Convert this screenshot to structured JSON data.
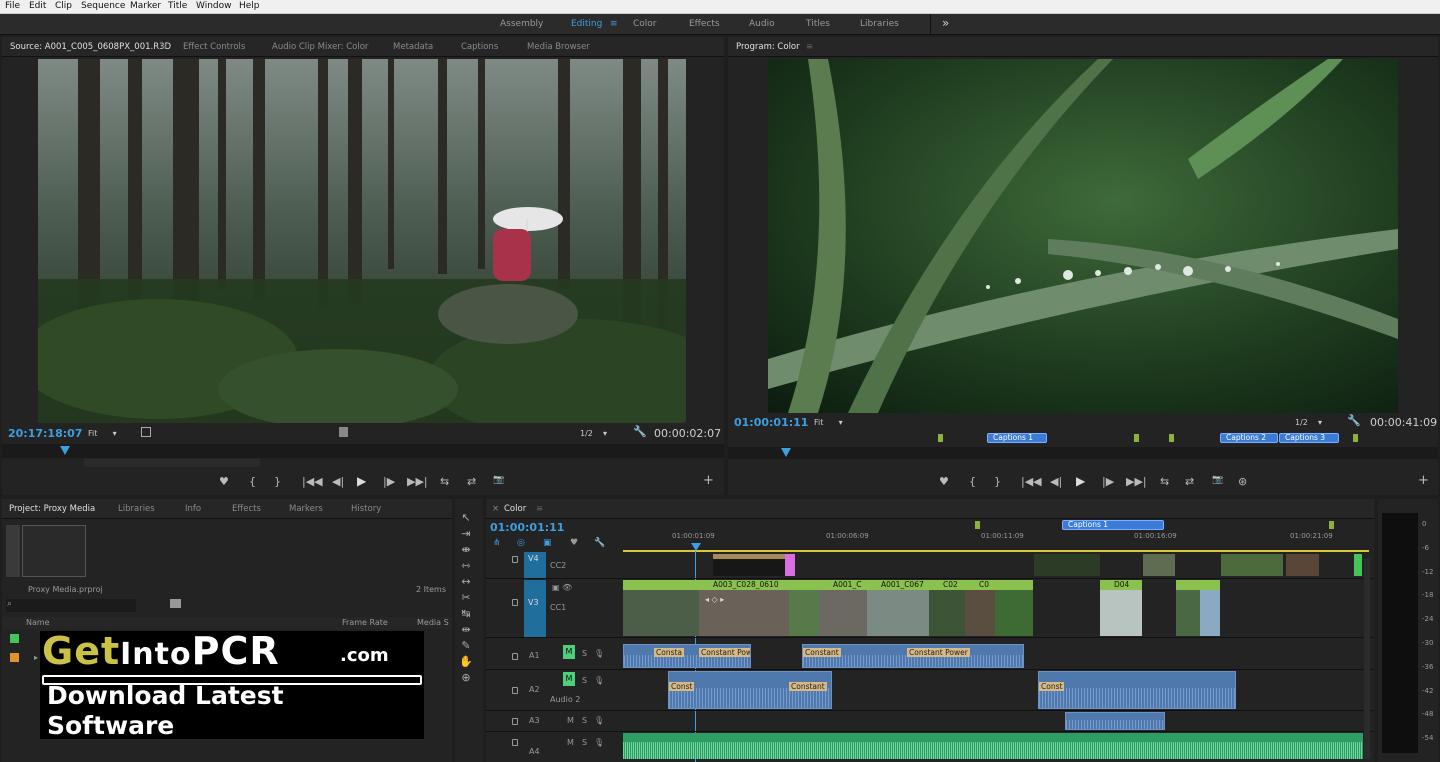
{
  "menu": [
    "File",
    "Edit",
    "Clip",
    "Sequence",
    "Marker",
    "Title",
    "Window",
    "Help"
  ],
  "workspaces": {
    "items": [
      "Assembly",
      "Editing",
      "Color",
      "Effects",
      "Audio",
      "Titles",
      "Libraries"
    ],
    "active": "Editing",
    "more": "»"
  },
  "source": {
    "tabs": [
      "Source: A001_C005_0608PX_001.R3D",
      "Effect Controls",
      "Audio Clip Mixer: Color",
      "Metadata",
      "Captions",
      "Media Browser"
    ],
    "timecode_left": "20:17:18:07",
    "fit": "Fit",
    "resolution": "1/2",
    "timecode_right": "00:00:02:07",
    "transport": [
      "♥",
      "{",
      "}",
      "|◀◀",
      "◀|",
      "▶",
      "|▶",
      "▶▶|",
      "⇆",
      "⇄",
      "📷"
    ],
    "add": "+"
  },
  "program": {
    "title": "Program: Color",
    "timecode_left": "01:00:01:11",
    "fit": "Fit",
    "resolution": "1/2",
    "timecode_right": "00:00:41:09",
    "captions": [
      "Captions 1",
      "Captions 2",
      "Captions 3"
    ],
    "transport": [
      "♥",
      "{",
      "}",
      "|◀◀",
      "◀|",
      "▶",
      "|▶",
      "▶▶|",
      "⇆",
      "⇄",
      "📷",
      "⊛"
    ],
    "add": "+"
  },
  "project": {
    "tabs": [
      "Project: Proxy Media",
      "Libraries",
      "Info",
      "Effects",
      "Markers",
      "History"
    ],
    "file": "Proxy Media.prproj",
    "items_count": "2 Items",
    "columns": [
      "Name",
      "Frame Rate",
      "Media S"
    ]
  },
  "timeline": {
    "tab": "Color",
    "timecode": "01:00:01:11",
    "ruler": [
      "01:00:01:09",
      "01:00:06:09",
      "01:00:11:09",
      "01:00:16:09",
      "01:00:21:09"
    ],
    "caption": "Captions 1",
    "tracks": {
      "v4": "V4",
      "cc2": "CC2",
      "v3": "V3",
      "cc1": "CC1",
      "a1": "A1",
      "a2": "A2",
      "audio2": "Audio 2",
      "a3": "A3",
      "a4": "A4"
    },
    "video_clips": [
      "A003_C028_0610",
      "A001_C",
      "A001_C067",
      "C02",
      "C0",
      "D04"
    ],
    "audio_clips": [
      "Consta",
      "Constant Power",
      "Constant",
      "Constant Power",
      "Const",
      "Const",
      "Constant",
      "Consta"
    ]
  },
  "meter": [
    "0",
    "-6",
    "-12",
    "-18",
    "-24",
    "-30",
    "-36",
    "-42",
    "-48",
    "-54"
  ],
  "watermark": {
    "brand_get": "Get",
    "brand_into": "Into",
    "brand_pcr": "PCR",
    "brand_com": ".com",
    "tagline1": "Download Latest",
    "tagline2": "Software"
  },
  "colors": {
    "accent_blue": "#3d9fe0",
    "video_clip_green": "#8bc24f",
    "audio_clip_blue": "#4f78ac",
    "audio_clip_green": "#2e9e66",
    "caption_blue": "#3b7bd8"
  }
}
